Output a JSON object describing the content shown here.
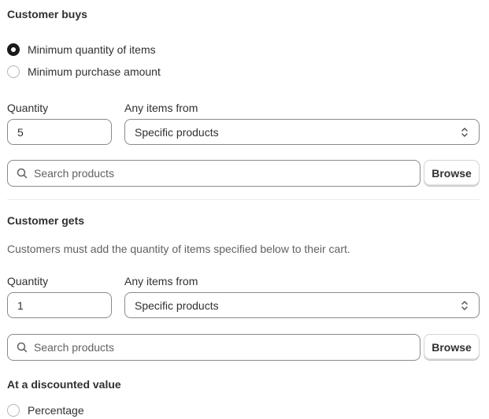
{
  "buys": {
    "heading": "Customer buys",
    "options": [
      {
        "label": "Minimum quantity of items",
        "checked": true
      },
      {
        "label": "Minimum purchase amount",
        "checked": false
      }
    ],
    "quantity_label": "Quantity",
    "quantity_value": "5",
    "items_from_label": "Any items from",
    "items_from_value": "Specific products",
    "search_placeholder": "Search products",
    "browse_label": "Browse"
  },
  "gets": {
    "heading": "Customer gets",
    "description": "Customers must add the quantity of items specified below to their cart.",
    "quantity_label": "Quantity",
    "quantity_value": "1",
    "items_from_label": "Any items from",
    "items_from_value": "Specific products",
    "search_placeholder": "Search products",
    "browse_label": "Browse"
  },
  "discount": {
    "heading": "At a discounted value",
    "options": [
      {
        "label": "Percentage",
        "checked": false
      }
    ]
  },
  "icons": {
    "search": "search-icon",
    "select_arrows": "chevron-up-down-icon"
  }
}
